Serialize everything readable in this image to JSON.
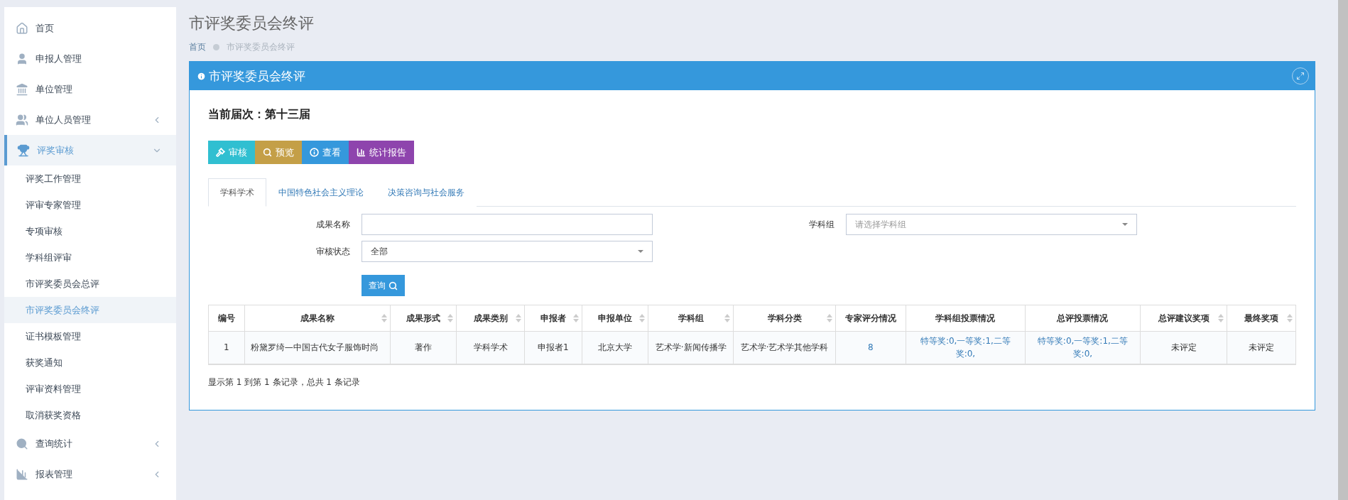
{
  "sidebar": {
    "items": [
      {
        "label": "首页",
        "selected": false
      },
      {
        "label": "申报人管理",
        "selected": false
      },
      {
        "label": "单位管理",
        "selected": false
      },
      {
        "label": "单位人员管理",
        "selected": false,
        "expanded": false
      },
      {
        "label": "评奖审核",
        "selected": true,
        "expanded": true,
        "children": [
          {
            "label": "评奖工作管理",
            "selected": false
          },
          {
            "label": "评审专家管理",
            "selected": false
          },
          {
            "label": "专项审核",
            "selected": false
          },
          {
            "label": "学科组评审",
            "selected": false
          },
          {
            "label": "市评奖委员会总评",
            "selected": false
          },
          {
            "label": "市评奖委员会终评",
            "selected": true
          },
          {
            "label": "证书模板管理",
            "selected": false
          },
          {
            "label": "获奖通知",
            "selected": false
          },
          {
            "label": "评审资料管理",
            "selected": false
          },
          {
            "label": "取消获奖资格",
            "selected": false
          }
        ]
      },
      {
        "label": "查询统计",
        "selected": false,
        "expanded": false
      },
      {
        "label": "报表管理",
        "selected": false,
        "expanded": false
      }
    ]
  },
  "page_title": "市评奖委员会终评",
  "breadcrumb": [
    "首页",
    "市评奖委员会终评"
  ],
  "panel": {
    "title": "市评奖委员会终评",
    "session": "当前届次：第十三届",
    "actions": [
      {
        "label": "审核",
        "color": "#30bfd1"
      },
      {
        "label": "预览",
        "color": "#c49f47"
      },
      {
        "label": "查看",
        "color": "#3598dc"
      },
      {
        "label": "统计报告",
        "color": "#8e44ad"
      }
    ],
    "tabs": [
      {
        "label": "学科学术",
        "selected": true
      },
      {
        "label": "中国特色社会主义理论",
        "selected": false
      },
      {
        "label": "决策咨询与社会服务",
        "selected": false
      }
    ],
    "filters": {
      "name": {
        "label": "成果名称"
      },
      "group": {
        "label": "学科组",
        "placeholder": "请选择学科组"
      },
      "status": {
        "label": "审核状态",
        "value": "全部"
      },
      "query": "查询"
    },
    "table": {
      "columns": [
        {
          "label": "编号",
          "sortable": false
        },
        {
          "label": "成果名称",
          "sortable": true
        },
        {
          "label": "成果形式",
          "sortable": true
        },
        {
          "label": "成果类别",
          "sortable": true
        },
        {
          "label": "申报者",
          "sortable": true
        },
        {
          "label": "申报单位",
          "sortable": true
        },
        {
          "label": "学科组",
          "sortable": true
        },
        {
          "label": "学科分类",
          "sortable": true
        },
        {
          "label": "专家评分情况",
          "sortable": false
        },
        {
          "label": "学科组投票情况",
          "sortable": false
        },
        {
          "label": "总评投票情况",
          "sortable": false
        },
        {
          "label": "总评建议奖项",
          "sortable": true
        },
        {
          "label": "最终奖项",
          "sortable": true
        }
      ],
      "rows": [
        [
          {
            "text": "1",
            "kind": "text"
          },
          {
            "text": "粉黛罗绮—中国古代女子服饰时尚",
            "kind": "text"
          },
          {
            "text": "著作",
            "kind": "text"
          },
          {
            "text": "学科学术",
            "kind": "text"
          },
          {
            "text": "申报者1",
            "kind": "text"
          },
          {
            "text": "北京大学",
            "kind": "text"
          },
          {
            "text": "艺术学·新闻传播学",
            "kind": "text"
          },
          {
            "text": "艺术学·艺术学其他学科",
            "kind": "text"
          },
          {
            "text": "8",
            "kind": "link"
          },
          {
            "text": "特等奖:0,一等奖:1,二等奖:0,",
            "kind": "link"
          },
          {
            "text": "特等奖:0,一等奖:1,二等奖:0,",
            "kind": "link"
          },
          {
            "text": "未评定",
            "kind": "text"
          },
          {
            "text": "未评定",
            "kind": "text"
          }
        ]
      ]
    },
    "summary": "显示第 1 到第 1 条记录，总共 1 条记录"
  }
}
